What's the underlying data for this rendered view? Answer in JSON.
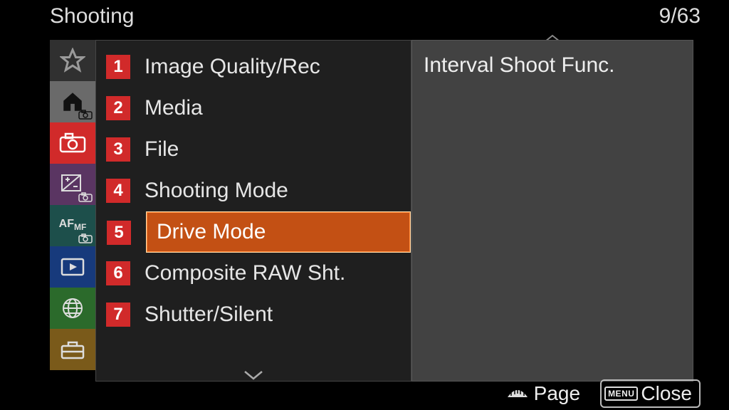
{
  "header": {
    "title": "Shooting",
    "page_indicator": "9/63"
  },
  "tabs": [
    {
      "name": "star",
      "label": "Favorites"
    },
    {
      "name": "home",
      "label": "Main"
    },
    {
      "name": "camera",
      "label": "Shooting"
    },
    {
      "name": "expos",
      "label": "Exposure"
    },
    {
      "name": "afmf",
      "label": "Focus",
      "text": "AF"
    },
    {
      "name": "play",
      "label": "Playback"
    },
    {
      "name": "globe",
      "label": "Network"
    },
    {
      "name": "setup",
      "label": "Setup"
    }
  ],
  "menu": {
    "items": [
      {
        "num": "1",
        "label": "Image Quality/Rec"
      },
      {
        "num": "2",
        "label": "Media"
      },
      {
        "num": "3",
        "label": "File"
      },
      {
        "num": "4",
        "label": "Shooting Mode"
      },
      {
        "num": "5",
        "label": "Drive Mode"
      },
      {
        "num": "6",
        "label": "Composite RAW Sht."
      },
      {
        "num": "7",
        "label": "Shutter/Silent"
      }
    ],
    "selected_index": 4
  },
  "detail": {
    "text": "Interval Shoot Func."
  },
  "footer": {
    "page_label": "Page",
    "close_badge": "MENU",
    "close_label": "Close"
  }
}
